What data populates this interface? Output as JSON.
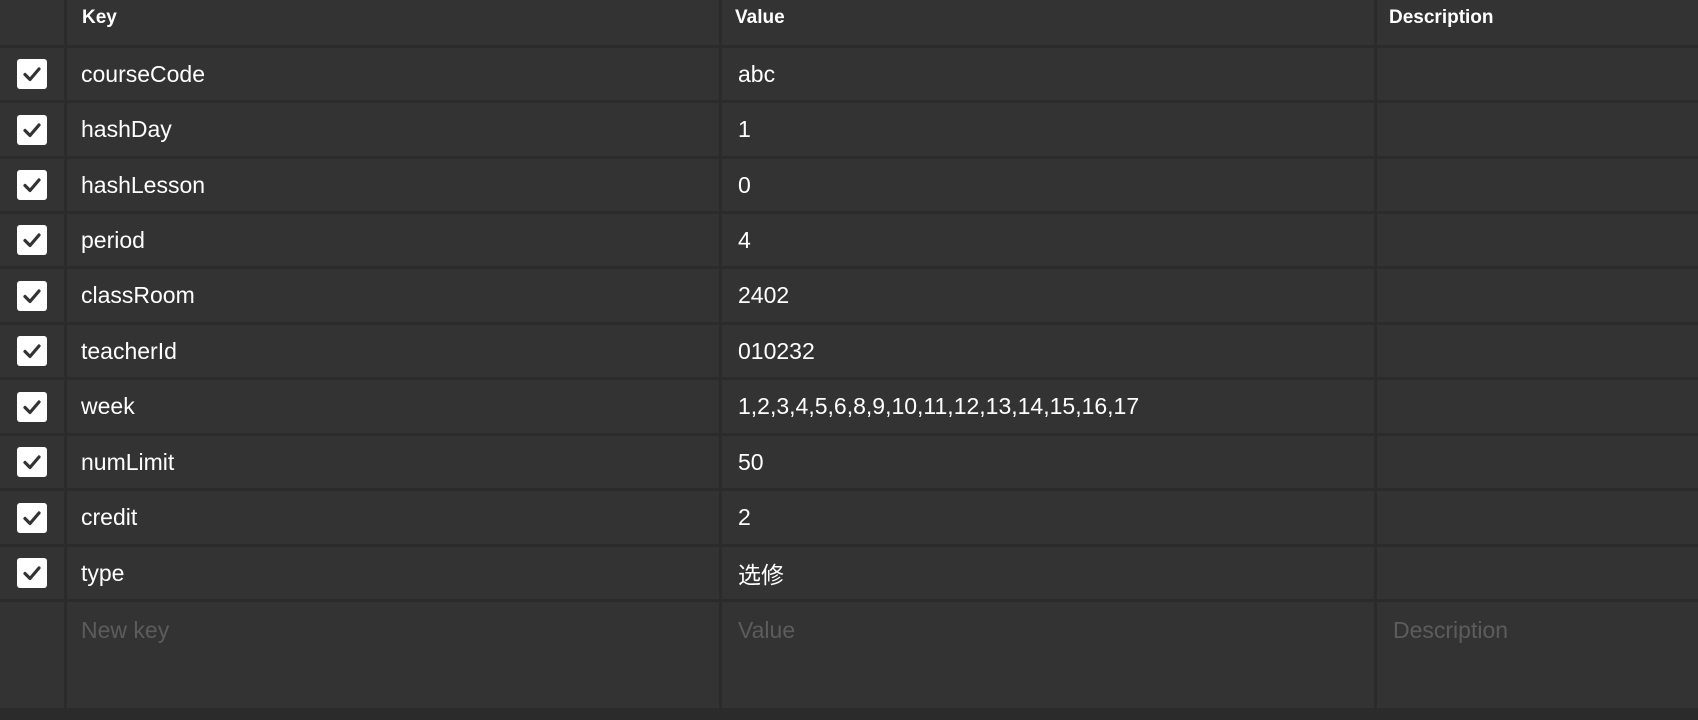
{
  "headers": {
    "key": "Key",
    "value": "Value",
    "description": "Description"
  },
  "rows": [
    {
      "key": "courseCode",
      "value": "abc",
      "description": "",
      "checked": true
    },
    {
      "key": "hashDay",
      "value": "1",
      "description": "",
      "checked": true
    },
    {
      "key": "hashLesson",
      "value": "0",
      "description": "",
      "checked": true
    },
    {
      "key": "period",
      "value": "4",
      "description": "",
      "checked": true
    },
    {
      "key": "classRoom",
      "value": "2402",
      "description": "",
      "checked": true
    },
    {
      "key": "teacherId",
      "value": "010232",
      "description": "",
      "checked": true
    },
    {
      "key": "week",
      "value": "1,2,3,4,5,6,8,9,10,11,12,13,14,15,16,17",
      "description": "",
      "checked": true
    },
    {
      "key": "numLimit",
      "value": "50",
      "description": "",
      "checked": true
    },
    {
      "key": "credit",
      "value": "2",
      "description": "",
      "checked": true
    },
    {
      "key": "type",
      "value": "选修",
      "description": "",
      "checked": true
    }
  ],
  "new_row": {
    "key_placeholder": "New key",
    "value_placeholder": "Value",
    "description_placeholder": "Description"
  },
  "icons": {
    "checkbox": "check-icon"
  },
  "colors": {
    "background": "#2b2b2b",
    "cell": "#333333",
    "text": "#ffffff",
    "placeholder": "#5c5c5c"
  }
}
